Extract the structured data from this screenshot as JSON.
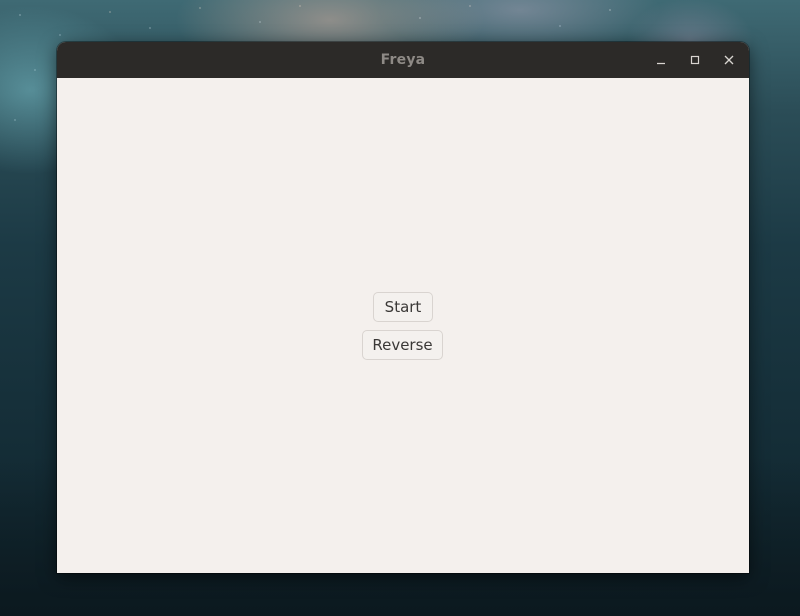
{
  "window": {
    "title": "Freya"
  },
  "controls": {
    "minimize": "minimize-icon",
    "maximize": "maximize-icon",
    "close": "close-icon"
  },
  "buttons": {
    "start_label": "Start",
    "reverse_label": "Reverse"
  },
  "colors": {
    "titlebar": "#2c2a28",
    "title_text": "#8e8a86",
    "content_bg": "#f4f0ed",
    "button_border": "#d9d4d0",
    "button_text": "#3a3836"
  }
}
